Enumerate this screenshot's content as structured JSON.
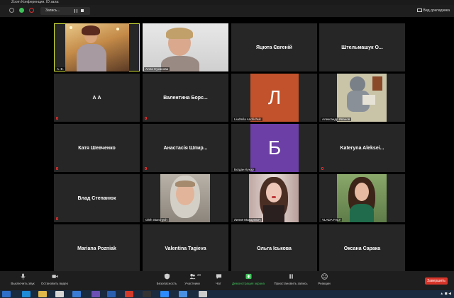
{
  "window": {
    "title": "Zoom Конференция. ID зала:"
  },
  "topbar": {
    "record_label": "Запись...",
    "view_label": "Вид докладчика"
  },
  "participants": [
    {
      "name": "А. Е.",
      "type": "video"
    },
    {
      "name": "Алла Суханова",
      "type": "video"
    },
    {
      "name": "Яцюта Євгеній",
      "type": "name"
    },
    {
      "name": "Штельмашук О...",
      "type": "name"
    },
    {
      "name": "А А",
      "type": "name"
    },
    {
      "name": "Валентина Борс...",
      "type": "name"
    },
    {
      "name": "Liudmila Andrichuk",
      "type": "letter",
      "letter": "Л",
      "color": "#c2522b"
    },
    {
      "name": "Александр Иванов",
      "type": "video"
    },
    {
      "name": "Катя Шевченко",
      "type": "name"
    },
    {
      "name": "Анастасія Шпир...",
      "type": "name"
    },
    {
      "name": "Богдан Кукар",
      "type": "letter",
      "letter": "Б",
      "color": "#6b3fa6"
    },
    {
      "name": "Kateryna Aleksei...",
      "type": "name"
    },
    {
      "name": "Влад Степанюк",
      "type": "name"
    },
    {
      "name": "Oleh Starchych",
      "type": "video"
    },
    {
      "name": "Лилия Макаревич",
      "type": "video"
    },
    {
      "name": "VLADA FALY",
      "type": "video"
    },
    {
      "name": "Mariana Pozniak",
      "type": "name"
    },
    {
      "name": "Valentina Tagieva",
      "type": "name"
    },
    {
      "name": "Ольга Іськова",
      "type": "name"
    },
    {
      "name": "Оксана Сарака",
      "type": "name"
    }
  ],
  "toolbar": {
    "mute": "Выключить звук",
    "stop_video": "Остановить видео",
    "security": "Безопасность",
    "participants": "Участники",
    "participants_count": "20",
    "chat": "Чат",
    "share": "Демонстрация экрана",
    "pause_record": "Приостановить запись",
    "reactions": "Реакции",
    "end": "Завершить"
  },
  "colors": {
    "share_accent": "#3fc45a",
    "end_button": "#d8352a",
    "active_speaker": "#d4e33a"
  }
}
